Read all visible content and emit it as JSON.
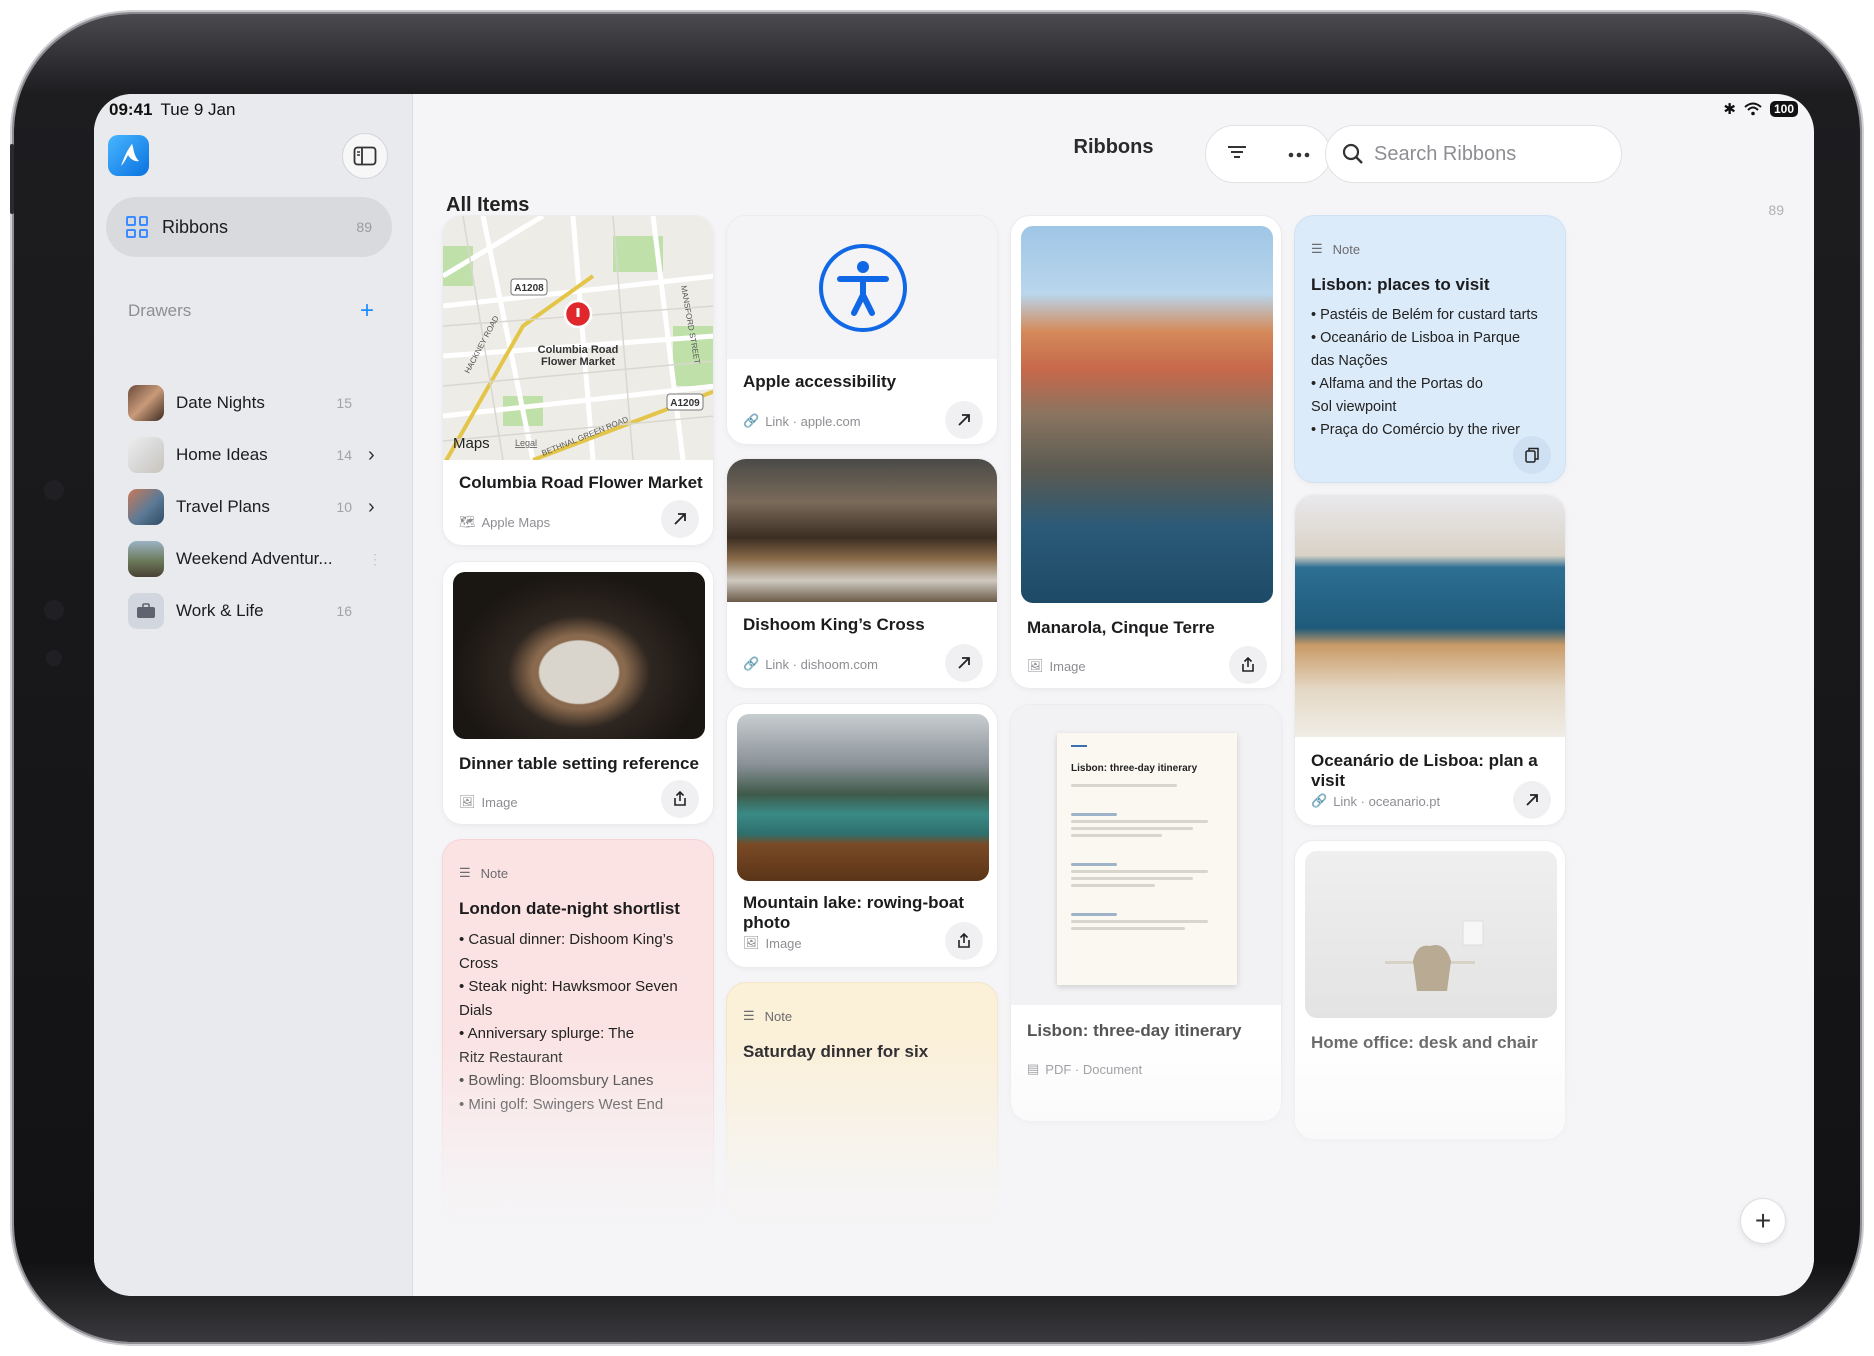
{
  "status": {
    "time": "09:41",
    "date": "Tue 9 Jan",
    "battery": "100"
  },
  "sidebar": {
    "nav": {
      "label": "Ribbons",
      "count": "89"
    },
    "drawers_label": "Drawers",
    "add_label": "+",
    "drawers": [
      {
        "label": "Date Nights",
        "count": "15",
        "chevron": ""
      },
      {
        "label": "Home Ideas",
        "count": "14",
        "chevron": "›"
      },
      {
        "label": "Travel Plans",
        "count": "10",
        "chevron": "›"
      },
      {
        "label": "Weekend Adventur...",
        "count": "",
        "chevron": ""
      },
      {
        "label": "Work & Life",
        "count": "16",
        "chevron": ""
      }
    ]
  },
  "header": {
    "title": "Ribbons",
    "search_placeholder": "Search Ribbons"
  },
  "section": {
    "title": "All Items",
    "count": "89"
  },
  "cards": {
    "map": {
      "title": "Columbia Road Flower Market",
      "meta": "Apple Maps",
      "map_label": "Columbia Road\nFlower Market",
      "roads": [
        "A1208",
        "A1209",
        "HACKNEY ROAD",
        "MANSFORD STREET",
        "BETHNAL GREEN ROAD"
      ],
      "maps_brand": "Maps",
      "legal": "Legal"
    },
    "dinner": {
      "title": "Dinner table setting reference",
      "meta": "Image"
    },
    "london_note": {
      "label": "Note",
      "title": "London date-night shortlist",
      "lines": [
        "• Casual dinner: Dishoom King’s Cross",
        "• Steak night: Hawksmoor Seven Dials",
        "• Anniversary splurge: The",
        "Ritz Restaurant",
        "• Bowling: Bloomsbury Lanes",
        "• Mini golf: Swingers West End"
      ]
    },
    "apple": {
      "title": "Apple accessibility",
      "meta": "Link · apple.com"
    },
    "dishoom": {
      "title": "Dishoom King’s Cross",
      "meta": "Link · dishoom.com"
    },
    "lake": {
      "title": "Mountain lake: rowing-boat photo",
      "meta": "Image"
    },
    "saturday_note": {
      "label": "Note",
      "title": "Saturday dinner for six"
    },
    "manarola": {
      "title": "Manarola, Cinque Terre",
      "meta": "Image"
    },
    "itinerary": {
      "title": "Lisbon: three-day itinerary",
      "doc_title": "Lisbon: three-day itinerary",
      "meta": "PDF · Document"
    },
    "lisbon_note": {
      "label": "Note",
      "title": "Lisbon: places to visit",
      "lines": [
        "• Pastéis de Belém for custard tarts",
        "• Oceanário de Lisboa in Parque",
        "das Nações",
        "• Alfama and the Portas do",
        "Sol viewpoint",
        "• Praça do Comércio by the river"
      ]
    },
    "oceanario": {
      "title": "Oceanário de Lisboa: plan a visit",
      "meta": "Link · oceanario.pt"
    },
    "office": {
      "title": "Home office: desk and chair"
    }
  },
  "colors": {
    "accent": "#1c8cff",
    "note_blue": "#dcebfa",
    "note_pink": "#fbe3e4",
    "note_yellow": "#fbf0d8"
  }
}
